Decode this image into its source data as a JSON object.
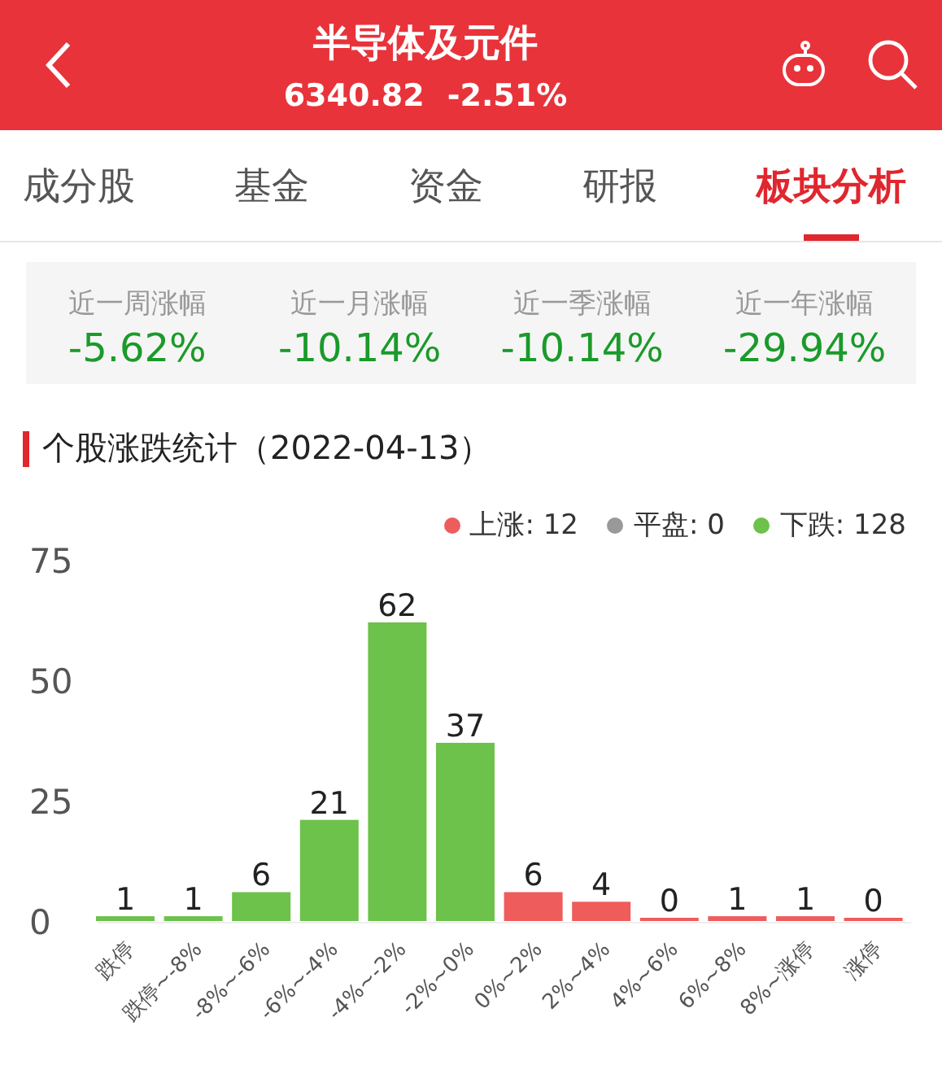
{
  "header": {
    "title": "半导体及元件",
    "price": "6340.82",
    "change": "-2.51%"
  },
  "tabs": [
    {
      "label": "成分股",
      "selected": false
    },
    {
      "label": "基金",
      "selected": false
    },
    {
      "label": "资金",
      "selected": false
    },
    {
      "label": "研报",
      "selected": false
    },
    {
      "label": "板块分析",
      "selected": true
    }
  ],
  "stats": [
    {
      "label": "近一周涨幅",
      "value": "-5.62%"
    },
    {
      "label": "近一月涨幅",
      "value": "-10.14%"
    },
    {
      "label": "近一季涨幅",
      "value": "-10.14%"
    },
    {
      "label": "近一年涨幅",
      "value": "-29.94%"
    }
  ],
  "section_title": "个股涨跌统计（2022-04-13）",
  "legend": [
    {
      "label": "上涨: 12",
      "color": "#ee5c5c"
    },
    {
      "label": "平盘: 0",
      "color": "#999999"
    },
    {
      "label": "下跌: 128",
      "color": "#6cc24a"
    }
  ],
  "chart_data": {
    "type": "bar",
    "categories": [
      "跌停",
      "跌停~-8%",
      "-8%~-6%",
      "-6%~-4%",
      "-4%~-2%",
      "-2%~0%",
      "0%~2%",
      "2%~4%",
      "4%~6%",
      "6%~8%",
      "8%~涨停",
      "涨停"
    ],
    "series": [
      {
        "color": "#6cc24a",
        "values": [
          1,
          1,
          6,
          21,
          62,
          37,
          null,
          null,
          null,
          null,
          null,
          null
        ]
      },
      {
        "color": "#ee5c5c",
        "values": [
          null,
          null,
          null,
          null,
          null,
          null,
          6,
          4,
          0,
          1,
          1,
          0
        ]
      }
    ],
    "ylim": [
      0,
      75
    ],
    "yticks": [
      0,
      25,
      50,
      75
    ],
    "data_labels": true
  }
}
